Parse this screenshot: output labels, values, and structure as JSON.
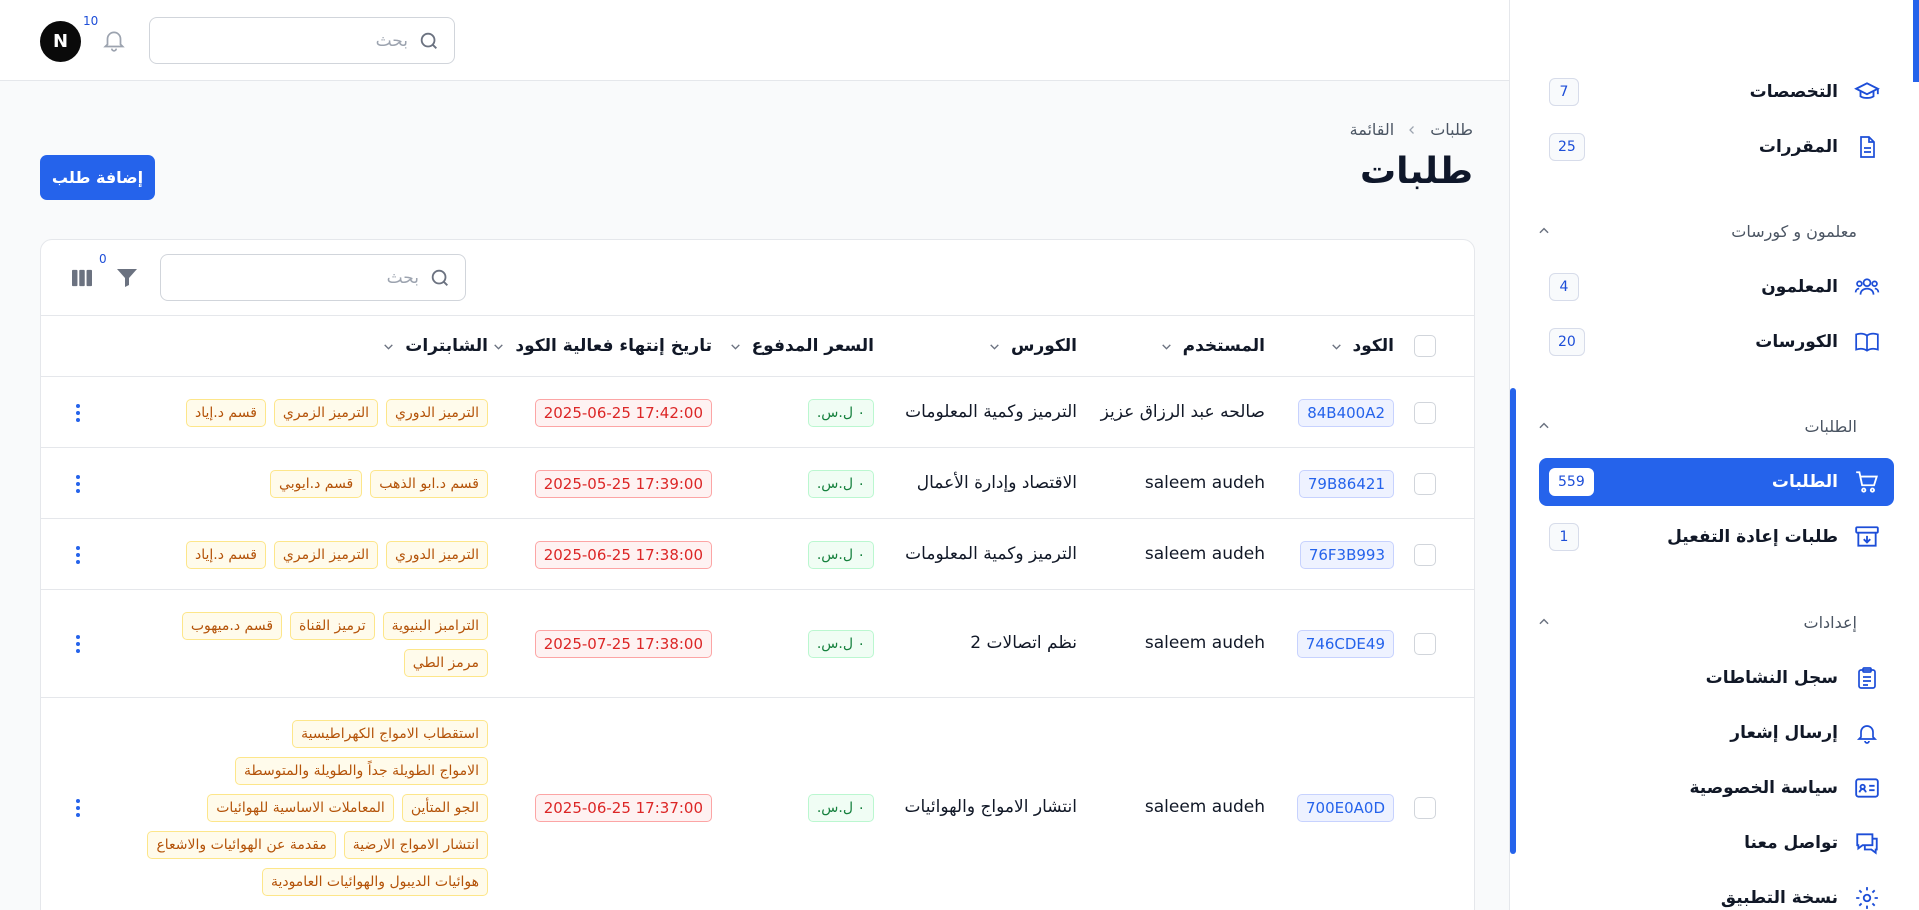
{
  "topbar": {
    "search_placeholder": "بحث",
    "notifications_count": "10",
    "avatar_letter": "N"
  },
  "breadcrumb": {
    "section": "طلبات",
    "current": "القائمة"
  },
  "page_title": "طلبات",
  "add_button_label": "إضافة طلب",
  "table_toolbar": {
    "search_placeholder": "بحث",
    "filter_count": "0"
  },
  "table": {
    "headers": {
      "code": "الكود",
      "user": "المستخدم",
      "course": "الكورس",
      "price": "السعر المدفوع",
      "expiry": "تاريخ إنتهاء فعالية الكود",
      "chapters": "الشابترات"
    },
    "rows": [
      {
        "code": "84B400A2",
        "user": "صالحه عبد الرزاق عزيز",
        "course": "الترميز وكمية المعلومات",
        "price": "٠ ل.س.",
        "expiry": "2025-06-25 17:42:00",
        "tag_lines": [
          [
            "الترميز الدوري",
            "الترميز الزمري",
            "قسم د.إياد"
          ]
        ]
      },
      {
        "code": "79B86421",
        "user": "saleem audeh",
        "course": "الاقتصاد وإدارة الأعمال",
        "price": "٠ ل.س.",
        "expiry": "2025-05-25 17:39:00",
        "tag_lines": [
          [
            "قسم د.ابو الذهب",
            "قسم د.ايوبي"
          ]
        ]
      },
      {
        "code": "76F3B993",
        "user": "saleem audeh",
        "course": "الترميز وكمية المعلومات",
        "price": "٠ ل.س.",
        "expiry": "2025-06-25 17:38:00",
        "tag_lines": [
          [
            "الترميز الدوري",
            "الترميز الزمري",
            "قسم د.إياد"
          ]
        ]
      },
      {
        "code": "746CDE49",
        "user": "saleem audeh",
        "course": "نظم اتصالات 2",
        "price": "٠ ل.س.",
        "expiry": "2025-07-25 17:38:00",
        "tag_lines": [
          [
            "الترامبز البنيوية",
            "ترميز القناة",
            "قسم د.ميهوب"
          ],
          [
            "مرمز الطي"
          ]
        ]
      },
      {
        "code": "700E0A0D",
        "user": "saleem audeh",
        "course": "انتشار الامواج والهوائيات",
        "price": "٠ ل.س.",
        "expiry": "2025-06-25 17:37:00",
        "tag_lines": [
          [
            "استقطاب الامواج الكهراطيسية"
          ],
          [
            "الامواج الطويلة جداً والطويلة والمتوسطة"
          ],
          [
            "الجو المتأين",
            "المعاملات الاساسية للهوائيات"
          ],
          [
            "انتشار الامواج الارضية",
            "مقدمة عن الهوائيات والاشعاع"
          ],
          [
            "هوائيات الديبول والهوائيات العامودية"
          ]
        ]
      }
    ]
  },
  "sidebar": {
    "items_top": [
      {
        "label": "التخصصات",
        "count": "7",
        "icon": "graduation-cap-icon"
      },
      {
        "label": "المقررات",
        "count": "25",
        "icon": "document-icon"
      }
    ],
    "group_teachers": "معلمون و كورسات",
    "items_teachers": [
      {
        "label": "المعلمون",
        "count": "4",
        "icon": "users-icon"
      },
      {
        "label": "الكورسات",
        "count": "20",
        "icon": "book-open-icon"
      }
    ],
    "group_orders": "الطلبات",
    "items_orders": [
      {
        "label": "الطلبات",
        "count": "559",
        "icon": "cart-icon"
      },
      {
        "label": "طلبات إعادة التفعيل",
        "count": "1",
        "icon": "archive-down-icon"
      }
    ],
    "group_settings": "إعدادات",
    "items_settings": [
      {
        "label": "سجل النشاطات",
        "icon": "clipboard-icon"
      },
      {
        "label": "إرسال إشعار",
        "icon": "bell-icon"
      },
      {
        "label": "سياسة الخصوصية",
        "icon": "id-card-icon"
      },
      {
        "label": "تواصل معنا",
        "icon": "chat-icon"
      },
      {
        "label": "نسخة التطبيق",
        "icon": "gear-icon"
      }
    ]
  },
  "colors": {
    "accent": "#2563eb",
    "tag": "#b45309",
    "date": "#dc2626",
    "price": "#15803d"
  }
}
